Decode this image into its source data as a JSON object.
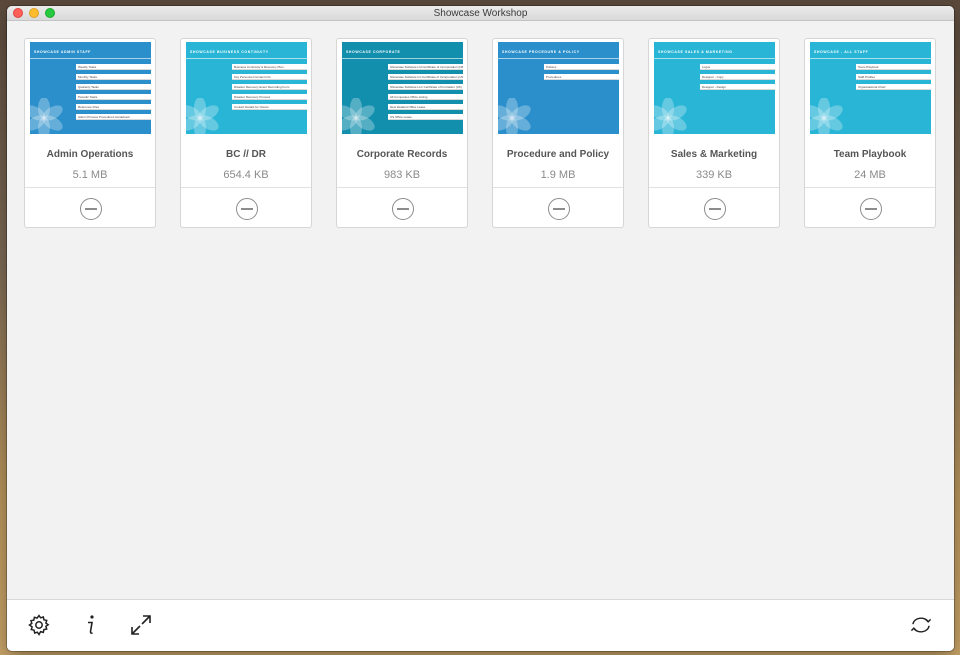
{
  "window": {
    "title": "Showcase Workshop"
  },
  "colors": {
    "thumb_blue": "#2a8fcb",
    "thumb_cyan": "#29b5d6",
    "thumb_teal": "#138fae",
    "text_gray": "#555555",
    "size_gray": "#8a8a8a"
  },
  "cards": [
    {
      "name": "Admin Operations",
      "size": "5.1 MB",
      "thumb_title": "SHOWCASE ADMIN STAFF",
      "thumb_color": "#2a8fcb",
      "rows": [
        "Weekly Tasks",
        "Monthly Tasks",
        "Quarterly Tasks",
        "Periodic Tasks",
        "Reference Files",
        "Admin Process Procedures Guidebook"
      ]
    },
    {
      "name": "BC // DR",
      "size": "654.4 KB",
      "thumb_title": "SHOWCASE BUSINESS CONTINUITY",
      "thumb_color": "#29b5d6",
      "rows": [
        "Business Continuity & Recovery Plan",
        "Key Personnel Contact Info",
        "Disaster Recovery Event Recording Form",
        "Disaster Recovery Process",
        "Contact Details for Clients"
      ]
    },
    {
      "name": "Corporate Records",
      "size": "983 KB",
      "thumb_title": "SHOWCASE CORPORATE",
      "thumb_color": "#138fae",
      "rows": [
        "Showcase Software Ltd Certificate of Incorporation (NZ)",
        "Showcase Software Inc Certificate of Incorporation (US)",
        "Showcase Software LLC Certificate of Formation (UK)",
        "All Companies Office Listing",
        "New Zealand Office Lease",
        "US Office Lease"
      ]
    },
    {
      "name": "Procedure and Policy",
      "size": "1.9 MB",
      "thumb_title": "SHOWCASE PROCEDURE & POLICY",
      "thumb_color": "#2a8fcb",
      "rows": [
        "Policies",
        "Procedures"
      ]
    },
    {
      "name": "Sales & Marketing",
      "size": "339 KB",
      "thumb_title": "SHOWCASE SALES & MARKETING",
      "thumb_color": "#29b5d6",
      "rows": [
        "Logos",
        "Designer - Copy",
        "Designer - Design"
      ]
    },
    {
      "name": "Team Playbook",
      "size": "24 MB",
      "thumb_title": "SHOWCASE - ALL STAFF",
      "thumb_color": "#29b5d6",
      "rows": [
        "Team Playbook",
        "Staff Profiles",
        "Organisational Chart"
      ]
    }
  ],
  "toolbar": {
    "icons": [
      "settings-gear-icon",
      "info-icon",
      "fullscreen-icon",
      "sync-icon"
    ]
  }
}
